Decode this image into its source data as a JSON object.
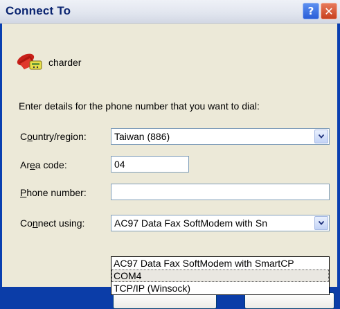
{
  "window": {
    "title": "Connect To",
    "help_button": "?",
    "close_button": "✕"
  },
  "connection": {
    "name": "charder",
    "icon": "telephone-modem-icon"
  },
  "instructions": "Enter details for the phone number that you want to dial:",
  "form": {
    "country_label_pre": "C",
    "country_label_ul": "o",
    "country_label_post": "untry/region:",
    "country_value": "Taiwan (886)",
    "area_label_pre": "Ar",
    "area_label_ul": "e",
    "area_label_post": "a code:",
    "area_value": "04",
    "phone_label_ul": "P",
    "phone_label_post": "hone number:",
    "phone_value": "",
    "connect_label_pre": "Co",
    "connect_label_ul": "n",
    "connect_label_post": "nect using:",
    "connect_value": "AC97 Data Fax SoftModem with Sn"
  },
  "dropdown": {
    "options": [
      "AC97 Data Fax SoftModem with SmartCP",
      "COM4",
      "TCP/IP (Winsock)"
    ],
    "selected_index": 1
  },
  "colors": {
    "dialog_bg": "#ece9d8",
    "title_text": "#0a2470",
    "field_border": "#7f9db9"
  }
}
